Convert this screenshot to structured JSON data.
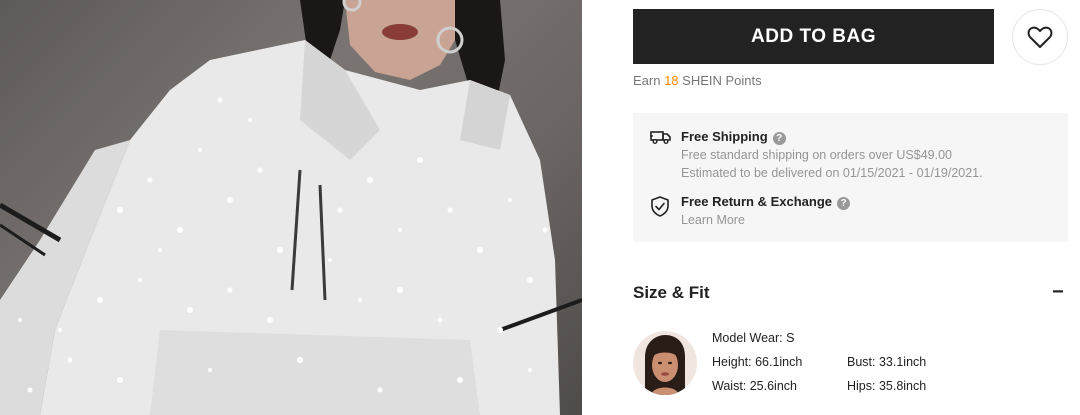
{
  "product_image": {
    "alt": "White glitter hoodie on model"
  },
  "actions": {
    "add_to_bag_label": "ADD TO BAG",
    "wishlist_icon": "heart-icon"
  },
  "points": {
    "prefix": "Earn ",
    "value": "18",
    "suffix": " SHEIN Points"
  },
  "shipping": {
    "title": "Free Shipping",
    "line1": "Free standard shipping on orders over US$49.00",
    "line2": "Estimated to be delivered on 01/15/2021 - 01/19/2021.",
    "icon": "truck-icon"
  },
  "returns": {
    "title": "Free Return & Exchange",
    "link": "Learn More",
    "icon": "shield-check-icon"
  },
  "size_fit": {
    "title": "Size & Fit",
    "toggle": "−",
    "model_wear": "Model Wear: S",
    "height": "Height: 66.1inch",
    "bust": "Bust: 33.1inch",
    "waist": "Waist: 25.6inch",
    "hips": "Hips: 35.8inch"
  },
  "colors": {
    "button_bg": "#222222",
    "points_accent": "#ff8c00",
    "panel_bg": "#f6f6f6",
    "muted_text": "#959595"
  }
}
